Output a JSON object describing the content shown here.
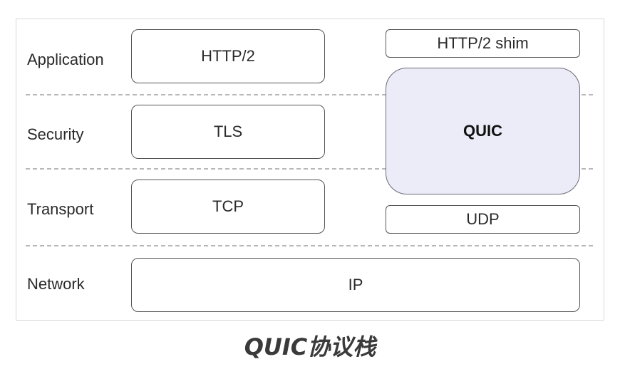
{
  "layers": {
    "application": "Application",
    "security": "Security",
    "transport": "Transport",
    "network": "Network"
  },
  "left_stack": {
    "http2": "HTTP/2",
    "tls": "TLS",
    "tcp": "TCP"
  },
  "right_stack": {
    "http2_shim": "HTTP/2 shim",
    "quic": "QUIC",
    "udp": "UDP"
  },
  "shared": {
    "ip": "IP"
  },
  "caption": "QUIC协议栈",
  "colors": {
    "quic_fill": "#ececf8",
    "border": "#555555",
    "divider": "#b8b8b8"
  }
}
